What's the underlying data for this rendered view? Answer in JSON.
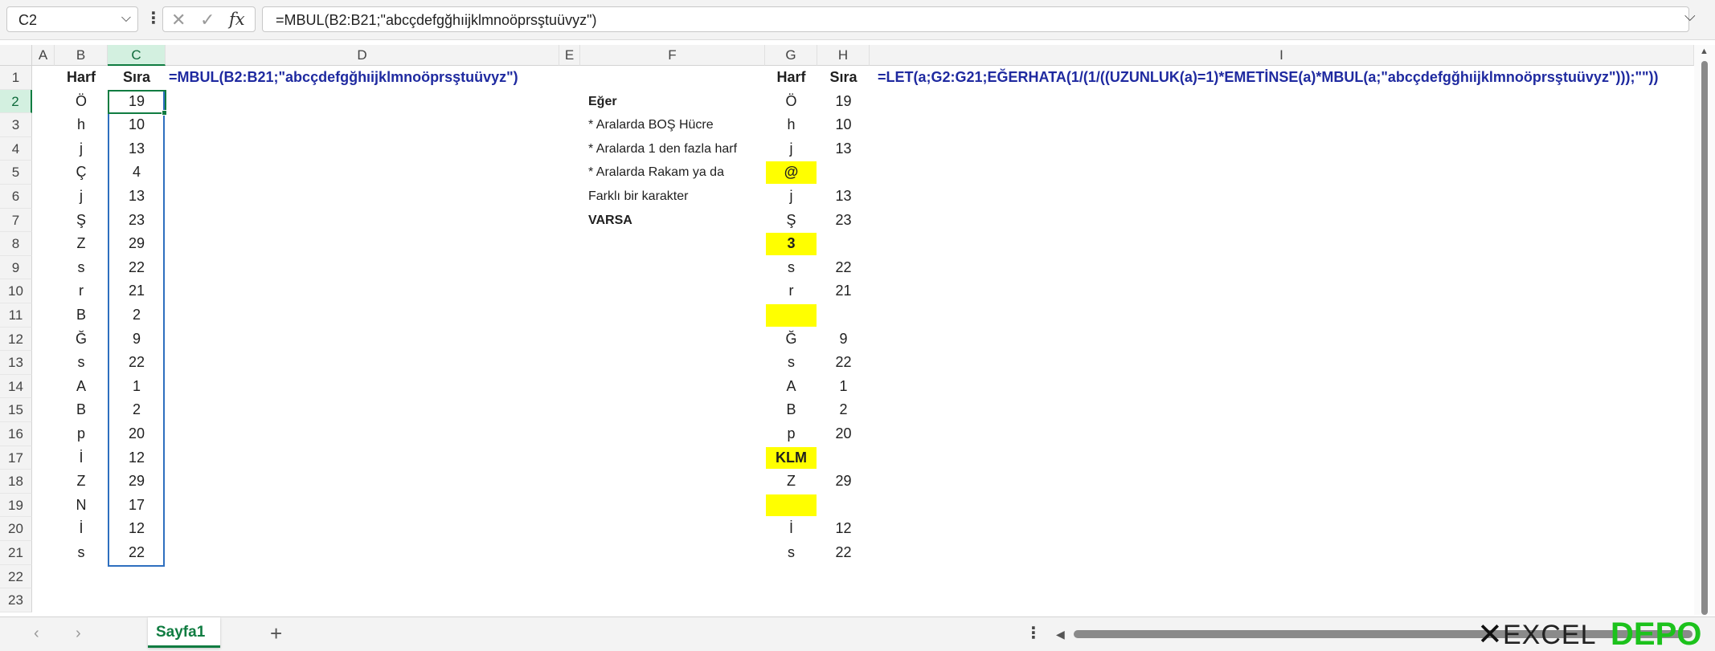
{
  "formula_bar": {
    "name_box": "C2",
    "cancel_glyph": "✕",
    "confirm_glyph": "✓",
    "fx_glyph": "fx",
    "formula": "=MBUL(B2:B21;\"abcçdefgğhıijklmnoöprsştuüvyz\")"
  },
  "columns": [
    "A",
    "B",
    "C",
    "D",
    "E",
    "F",
    "G",
    "H",
    "I"
  ],
  "rows": [
    "1",
    "2",
    "3",
    "4",
    "5",
    "6",
    "7",
    "8",
    "9",
    "10",
    "11",
    "12",
    "13",
    "14",
    "15",
    "16",
    "17",
    "18",
    "19",
    "20",
    "21",
    "22",
    "23"
  ],
  "sheet": {
    "headers": {
      "b1": "Harf",
      "c1": "Sıra",
      "d1": "=MBUL(B2:B21;\"abcçdefgğhıijklmnoöprsştuüvyz\")",
      "g1": "Harf",
      "h1": "Sıra",
      "i1": "=LET(a;G2:G21;EĞERHATA(1/(1/((UZUNLUK(a)=1)*EMETİNSE(a)*MBUL(a;\"abcçdefgğhıijklmnoöprsştuüvyz\")));\"\"))"
    },
    "col_b": [
      "Ö",
      "h",
      "j",
      "Ç",
      "j",
      "Ş",
      "Z",
      "s",
      "r",
      "B",
      "Ğ",
      "s",
      "A",
      "B",
      "p",
      "İ",
      "Z",
      "N",
      "İ",
      "s"
    ],
    "col_c": [
      "19",
      "10",
      "13",
      "4",
      "13",
      "23",
      "29",
      "22",
      "21",
      "2",
      "9",
      "22",
      "1",
      "2",
      "20",
      "12",
      "29",
      "17",
      "12",
      "22"
    ],
    "col_f": [
      "Eğer",
      "* Aralarda BOŞ Hücre",
      "* Aralarda 1 den fazla harf",
      "* Aralarda Rakam ya da",
      "Farklı bir karakter",
      "VARSA"
    ],
    "col_g": [
      "Ö",
      "h",
      "j",
      "@",
      "j",
      "Ş",
      "3",
      "s",
      "r",
      "",
      "Ğ",
      "s",
      "A",
      "B",
      "p",
      "KLM",
      "Z",
      "",
      "İ",
      "s"
    ],
    "col_h": [
      "19",
      "10",
      "13",
      "",
      "13",
      "23",
      "",
      "22",
      "21",
      "",
      "9",
      "22",
      "1",
      "2",
      "20",
      "",
      "29",
      "",
      "12",
      "22"
    ]
  },
  "tabs": {
    "active": "Sayfa1",
    "add": "+",
    "prev": "‹",
    "next": "›",
    "more": "⋮"
  },
  "logo": {
    "x": "✕",
    "excel": "EXCEL",
    "depo": "DEPO"
  },
  "colors": {
    "accent": "#107c41",
    "highlight": "#ffff00",
    "formula_text": "#1f2aa0",
    "selection": "#2e6fbf"
  }
}
